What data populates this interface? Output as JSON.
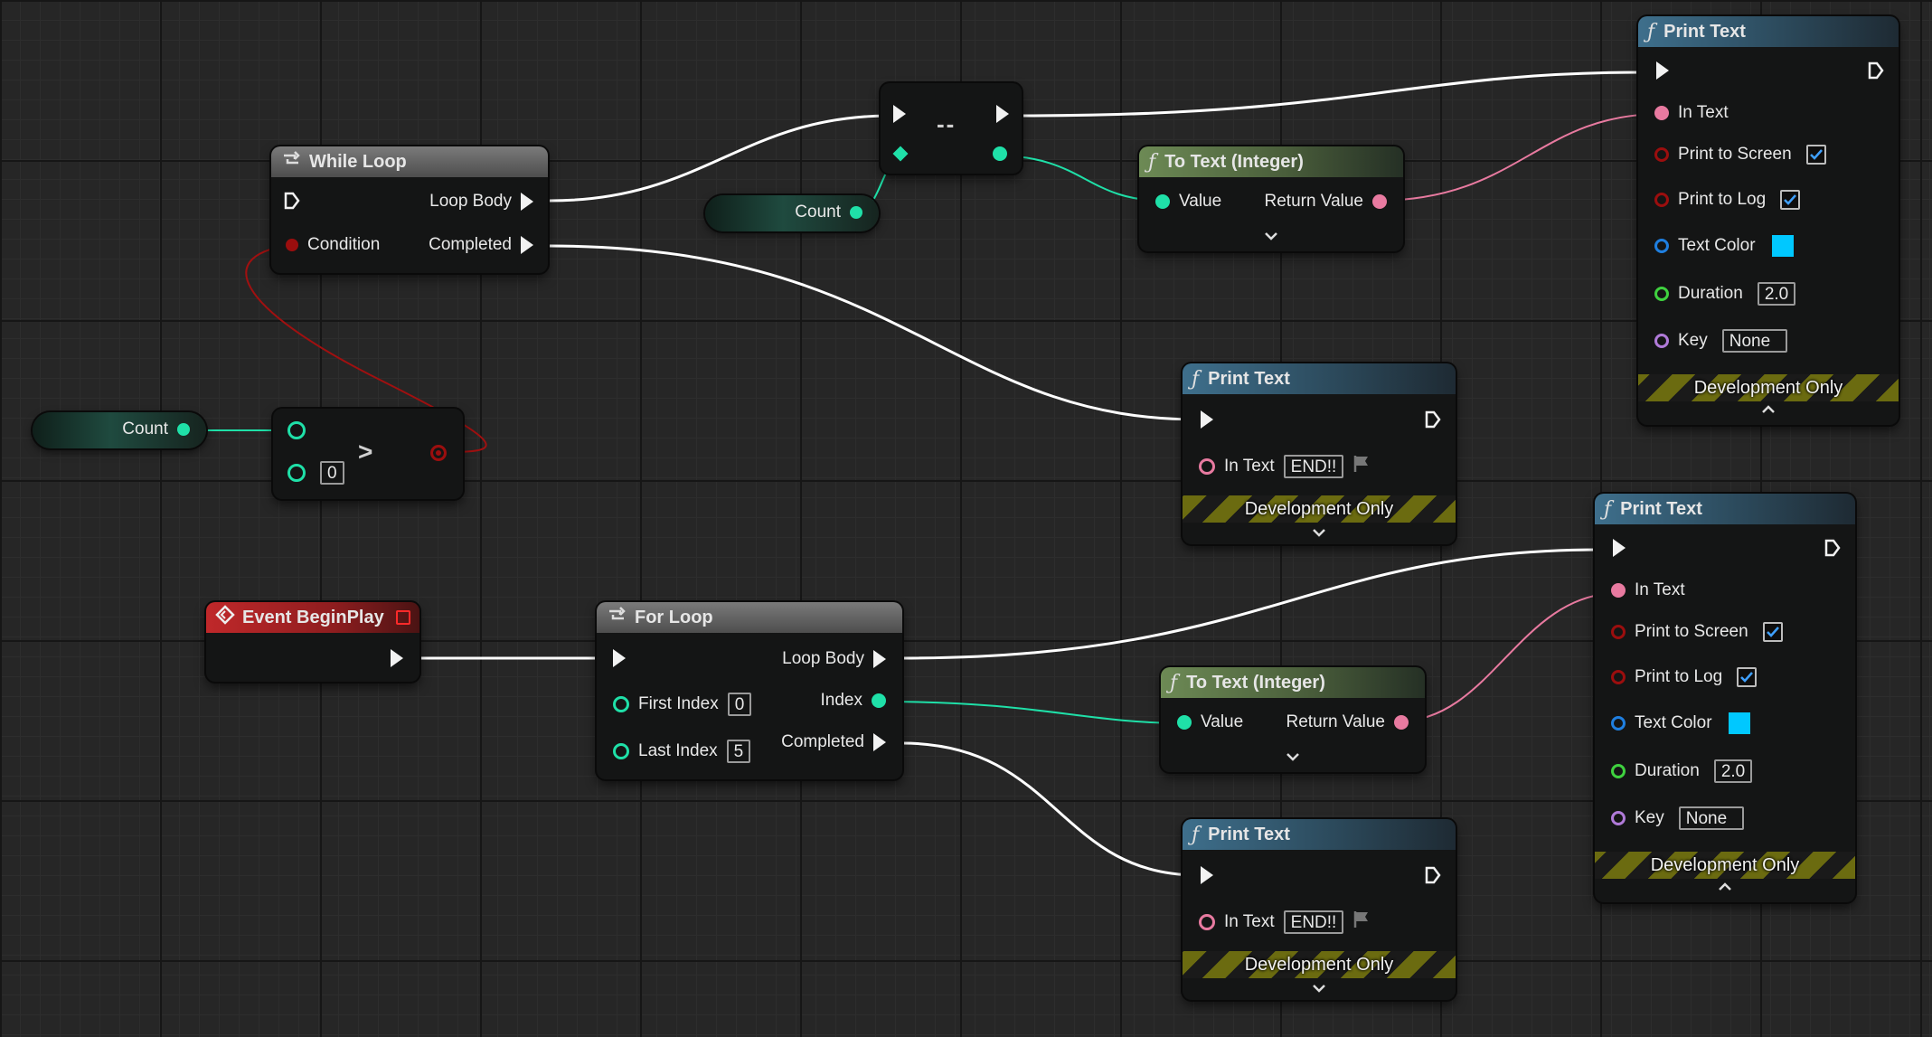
{
  "while_loop": {
    "title": "While Loop",
    "pins": {
      "condition": "Condition",
      "loop_body": "Loop Body",
      "completed": "Completed"
    }
  },
  "count_var_1": {
    "label": "Count"
  },
  "count_var_2": {
    "label": "Count"
  },
  "greater_node": {
    "symbol": ">",
    "b_value": "0"
  },
  "decrement_node": {
    "symbol": "--"
  },
  "to_text_1": {
    "title": "To Text (Integer)",
    "value": "Value",
    "return_value": "Return Value"
  },
  "to_text_2": {
    "title": "To Text (Integer)",
    "value": "Value",
    "return_value": "Return Value"
  },
  "print_text_top": {
    "title": "Print Text",
    "in_text": "In Text",
    "print_to_screen": "Print to Screen",
    "print_to_log": "Print to Log",
    "text_color": "Text Color",
    "duration": "Duration",
    "duration_value": "2.0",
    "key": "Key",
    "key_value": "None",
    "dev_only": "Development Only"
  },
  "print_text_end_1": {
    "title": "Print Text",
    "in_text": "In Text",
    "in_text_value": "END!!",
    "dev_only": "Development Only"
  },
  "print_text_end_2": {
    "title": "Print Text",
    "in_text": "In Text",
    "in_text_value": "END!!",
    "dev_only": "Development Only"
  },
  "print_text_mid": {
    "title": "Print Text",
    "in_text": "In Text",
    "print_to_screen": "Print to Screen",
    "print_to_log": "Print to Log",
    "text_color": "Text Color",
    "duration": "Duration",
    "duration_value": "2.0",
    "key": "Key",
    "key_value": "None",
    "dev_only": "Development Only"
  },
  "event_begin_play": {
    "title": "Event BeginPlay"
  },
  "for_loop": {
    "title": "For Loop",
    "first_index": "First Index",
    "first_index_value": "0",
    "last_index": "Last Index",
    "last_index_value": "5",
    "loop_body": "Loop Body",
    "index": "Index",
    "completed": "Completed"
  },
  "colors": {
    "exec": "#ffffff",
    "integer": "#1fe0a8",
    "string_text": "#e87aa0",
    "bool": "#9b0e0e",
    "struct_color": "#1f7fe0",
    "float": "#3fd13f",
    "name": "#b07ad8",
    "text_color_value": "#00c8ff"
  }
}
